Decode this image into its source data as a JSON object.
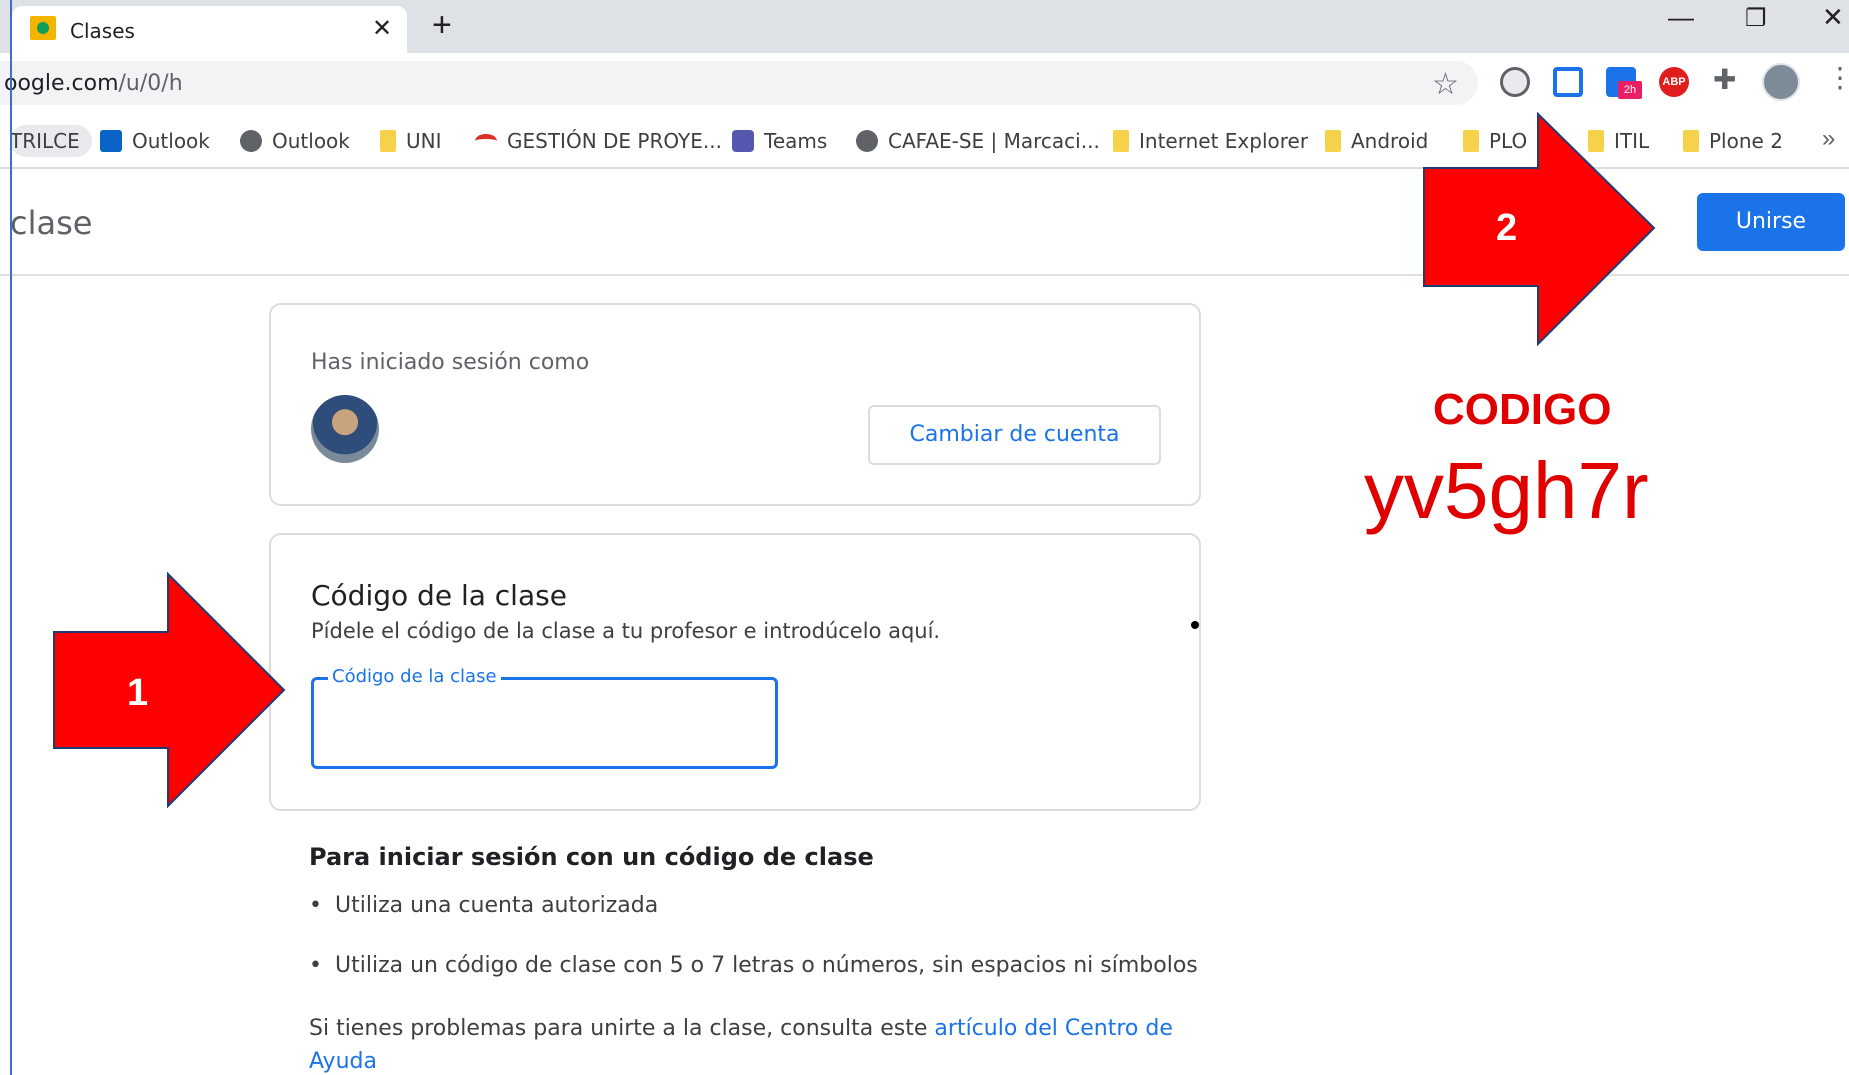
{
  "browser": {
    "tab_title": "Clases",
    "url_host": "oogle.com",
    "url_path": "/u/0/h"
  },
  "bookmarks": [
    {
      "label": "TRILCE",
      "icon": "none"
    },
    {
      "label": "Outlook",
      "icon": "outlook-icon"
    },
    {
      "label": "Outlook",
      "icon": "globe-icon"
    },
    {
      "label": "UNI",
      "icon": "folder-icon"
    },
    {
      "label": "GESTIÓN DE PROYE...",
      "icon": "arc-icon"
    },
    {
      "label": "Teams",
      "icon": "teams-icon"
    },
    {
      "label": "CAFAE-SE | Marcaci...",
      "icon": "globe-icon"
    },
    {
      "label": "Internet Explorer",
      "icon": "folder-icon"
    },
    {
      "label": "Android",
      "icon": "folder-icon"
    },
    {
      "label": "PLO",
      "icon": "folder-icon"
    },
    {
      "label": "ITIL",
      "icon": "folder-icon"
    },
    {
      "label": "Plone 2",
      "icon": "folder-icon"
    }
  ],
  "header": {
    "title": "clase",
    "join_label": "Unirse"
  },
  "account": {
    "label": "Has iniciado sesión como",
    "switch_label": "Cambiar de cuenta"
  },
  "code_card": {
    "heading": "Código de la clase",
    "description": "Pídele el código de la clase a tu profesor e introdúcelo aquí.",
    "field_label": "Código de la clase",
    "field_value": ""
  },
  "instructions": {
    "heading": "Para iniciar sesión con un código de clase",
    "bullets": [
      "Utiliza una cuenta autorizada",
      "Utiliza un código de clase con 5 o 7 letras o números, sin espacios ni símbolos"
    ],
    "help_prefix": "Si tienes problemas para unirte a la clase, consulta este ",
    "help_link": "artículo del Centro de Ayuda"
  },
  "annotations": {
    "arrow1_number": "1",
    "arrow2_number": "2",
    "code_title": "CODIGO",
    "code_value": "yv5gh7r",
    "color": "#e00000"
  },
  "colors": {
    "accent": "#1a73e8",
    "annotation_red": "#ff0000"
  }
}
